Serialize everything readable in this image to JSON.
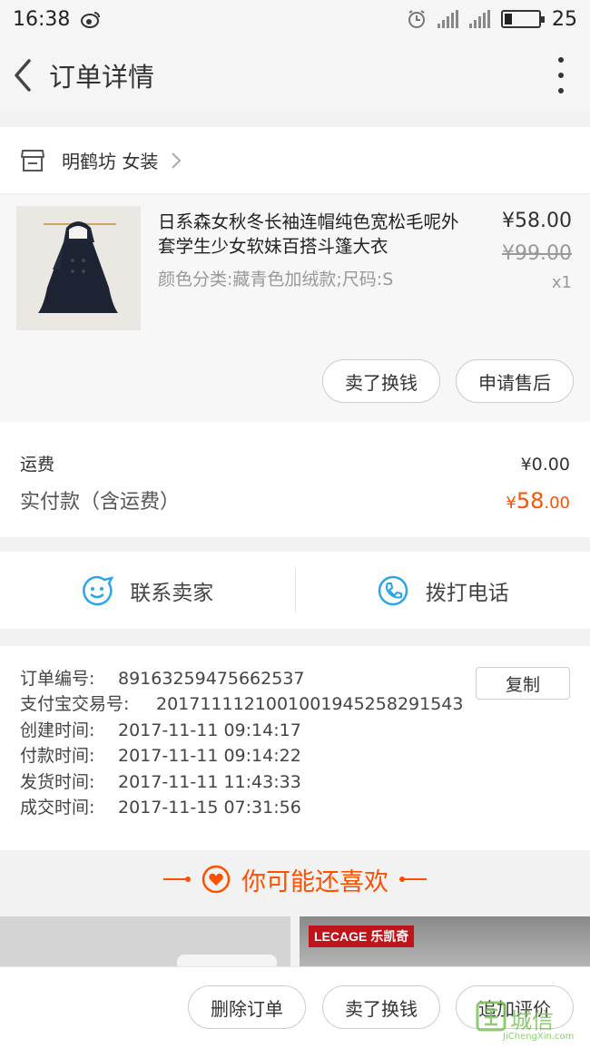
{
  "status_bar": {
    "time": "16:38",
    "battery": "25"
  },
  "header": {
    "title": "订单详情"
  },
  "shop": {
    "name": "明鹤坊 女装"
  },
  "item": {
    "title": "日系森女秋冬长袖连帽纯色宽松毛呢外套学生少女软妹百搭斗篷大衣",
    "sku": "颜色分类:藏青色加绒款;尺码:S",
    "price": "¥58.00",
    "original_price": "¥99.00",
    "quantity": "x1",
    "sell_button": "卖了换钱",
    "after_sale_button": "申请售后"
  },
  "fees": {
    "shipping_label": "运费",
    "shipping_value": "¥0.00",
    "paid_label": "实付款（含运费）",
    "paid_currency": "¥",
    "paid_int": "58",
    "paid_dec": ".00"
  },
  "contact": {
    "seller_label": "联系卖家",
    "call_label": "拨打电话"
  },
  "order_info": {
    "copy_button": "复制",
    "rows": [
      {
        "key": "订单编号:",
        "value": "89163259475662537"
      },
      {
        "key": "支付宝交易号:",
        "value": "2017111121001001945258291543"
      },
      {
        "key": "创建时间:",
        "value": "2017-11-11 09:14:17"
      },
      {
        "key": "付款时间:",
        "value": "2017-11-11 09:14:22"
      },
      {
        "key": "发货时间:",
        "value": "2017-11-11 11:43:33"
      },
      {
        "key": "成交时间:",
        "value": "2017-11-15 07:31:56"
      }
    ]
  },
  "recommend": {
    "title": "你可能还喜欢"
  },
  "product_right": {
    "brand": "LECAGE 乐凯奇"
  },
  "bottom_bar": {
    "delete_button": "删除订单",
    "sell_button": "卖了换钱",
    "review_button": "追加评价"
  },
  "watermark": {
    "text": "城信",
    "sub": "JiChengXin.com"
  },
  "colors": {
    "accent": "#ff5000",
    "icon_blue": "#2aa6e8"
  }
}
